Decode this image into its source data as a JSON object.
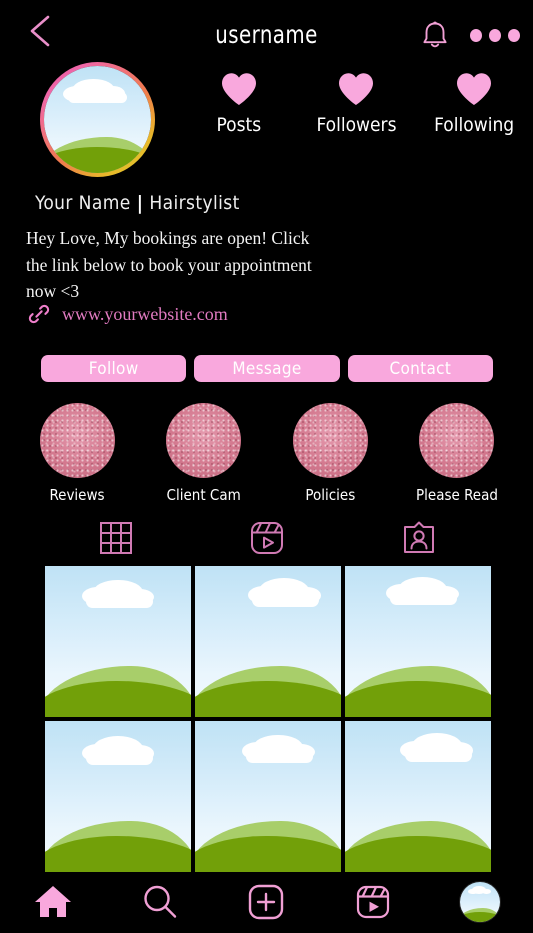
{
  "header": {
    "back_icon": "chevron-left-icon",
    "username": "username",
    "bell_icon": "bell-icon",
    "more_icon": "more-dots-icon"
  },
  "profile": {
    "avatar_icon": "profile-avatar-placeholder",
    "display_name": "Your Name",
    "separator": "|",
    "occupation": "Hairstylist",
    "bio": "Hey Love, My bookings are open! Click the link below to book your appointment now <3",
    "link_icon": "link-chain-icon",
    "link_text": "www.yourwebsite.com"
  },
  "stats": [
    {
      "icon": "heart-icon",
      "label": "Posts"
    },
    {
      "icon": "heart-icon",
      "label": "Followers"
    },
    {
      "icon": "heart-icon",
      "label": "Following"
    }
  ],
  "actions": [
    {
      "label": "Follow",
      "name": "follow-button"
    },
    {
      "label": "Message",
      "name": "message-button"
    },
    {
      "label": "Contact",
      "name": "contact-button"
    }
  ],
  "highlights": [
    {
      "label": "Reviews"
    },
    {
      "label": "Client Cam"
    },
    {
      "label": "Policies"
    },
    {
      "label": "Please Read"
    }
  ],
  "tabs": [
    {
      "icon": "grid-icon",
      "name": "tab-grid",
      "selected": true
    },
    {
      "icon": "reels-icon",
      "name": "tab-reels",
      "selected": false
    },
    {
      "icon": "tagged-person-icon",
      "name": "tab-tagged",
      "selected": false
    }
  ],
  "grid_posts": [
    {
      "alt": "landscape-placeholder"
    },
    {
      "alt": "landscape-placeholder"
    },
    {
      "alt": "landscape-placeholder"
    },
    {
      "alt": "landscape-placeholder"
    },
    {
      "alt": "landscape-placeholder"
    },
    {
      "alt": "landscape-placeholder"
    }
  ],
  "bottom_nav": [
    {
      "icon": "home-icon",
      "name": "nav-home"
    },
    {
      "icon": "search-icon",
      "name": "nav-search"
    },
    {
      "icon": "plus-square-icon",
      "name": "nav-create"
    },
    {
      "icon": "reels-icon",
      "name": "nav-reels"
    },
    {
      "icon": "profile-avatar-icon",
      "name": "nav-profile"
    }
  ],
  "colors": {
    "background": "#000000",
    "pink": "#f9a8dd",
    "pink_outline": "#e98fc9",
    "link_pink": "#e07ac0",
    "highlight_pink": "#d3788e",
    "text": "#ffffff"
  }
}
